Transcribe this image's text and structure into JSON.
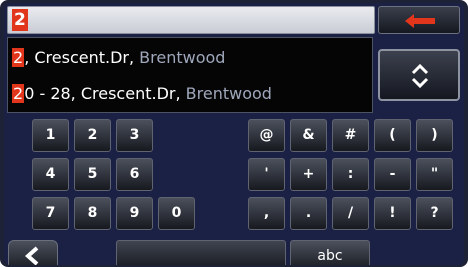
{
  "input": {
    "value": "2"
  },
  "results": [
    {
      "match": "2",
      "rest": ", Crescent.Dr, ",
      "town": "Brentwood"
    },
    {
      "match": "2",
      "rest": "0 - 28, Crescent.Dr, ",
      "town": "Brentwood"
    }
  ],
  "keypad": {
    "row1": [
      "1",
      "2",
      "3",
      "@",
      "&",
      "#",
      "(",
      ")"
    ],
    "row2": [
      "4",
      "5",
      "6",
      "'",
      "+",
      ":",
      "-",
      "\""
    ],
    "row3": [
      "7",
      "8",
      "9",
      "0",
      ",",
      ".",
      "/",
      "!",
      "?"
    ],
    "mode_label": "abc"
  },
  "colors": {
    "accent": "#e2361c",
    "background": "#1a2145"
  }
}
